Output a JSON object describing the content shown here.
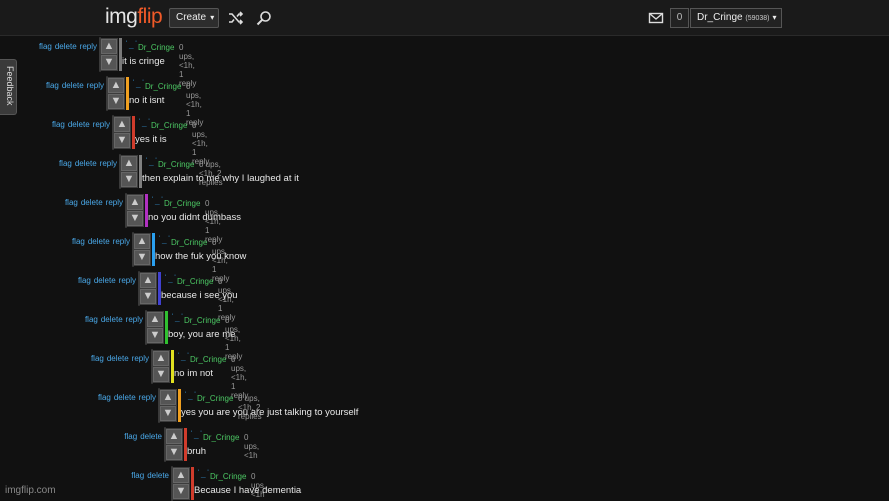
{
  "header": {
    "logo_main": "img",
    "logo_accent": "flip",
    "create_label": "Create",
    "shuffle_icon": "shuffle-icon",
    "search_icon": "search-icon",
    "mail_icon": "mail-icon",
    "notification_count": "0",
    "username": "Dr_Cringe",
    "points": "(59038)"
  },
  "feedback_label": "Feedback",
  "watermark": "imgflip.com",
  "colors": {
    "depth": [
      "#7a7a7a",
      "#f0a020",
      "#d03c2c",
      "#808080",
      "#b030c0",
      "#2aa0f0",
      "#4040d0",
      "#30c030",
      "#e0e020",
      "#f0a020",
      "#d03c2c",
      "#d03c2c"
    ],
    "username": "#4cc864",
    "link": "#4aa8e8"
  },
  "comments": [
    {
      "user": "Dr_Cringe",
      "meta": "0 ups, <1h, 1 reply",
      "text": "it is cringe",
      "actions": [
        "flag",
        "delete",
        "reply"
      ]
    },
    {
      "user": "Dr_Cringe",
      "meta": "0 ups, <1h, 1 reply",
      "text": "no it isnt",
      "actions": [
        "flag",
        "delete",
        "reply"
      ]
    },
    {
      "user": "Dr_Cringe",
      "meta": "0 ups, <1h, 1 reply",
      "text": "yes it is",
      "actions": [
        "flag",
        "delete",
        "reply"
      ]
    },
    {
      "user": "Dr_Cringe",
      "meta": "0 ups, <1h, 2 replies",
      "text": "then explain to me why I laughed at it",
      "actions": [
        "flag",
        "delete",
        "reply"
      ]
    },
    {
      "user": "Dr_Cringe",
      "meta": "0 ups, <1h, 1 reply",
      "text": "no you didnt dumbass",
      "actions": [
        "flag",
        "delete",
        "reply"
      ]
    },
    {
      "user": "Dr_Cringe",
      "meta": "0 ups, <1h, 1 reply",
      "text": "how the fuk you know",
      "actions": [
        "flag",
        "delete",
        "reply"
      ]
    },
    {
      "user": "Dr_Cringe",
      "meta": "0 ups, <1h, 1 reply",
      "text": "because i see you",
      "actions": [
        "flag",
        "delete",
        "reply"
      ]
    },
    {
      "user": "Dr_Cringe",
      "meta": "0 ups, <1h, 1 reply",
      "text": "boy, you are me",
      "actions": [
        "flag",
        "delete",
        "reply"
      ]
    },
    {
      "user": "Dr_Cringe",
      "meta": "0 ups, <1h, 1 reply",
      "text": "no im not",
      "actions": [
        "flag",
        "delete",
        "reply"
      ]
    },
    {
      "user": "Dr_Cringe",
      "meta": "0 ups, <1h, 2 replies",
      "text": "yes you are you are just talking to yourself",
      "actions": [
        "flag",
        "delete",
        "reply"
      ]
    },
    {
      "user": "Dr_Cringe",
      "meta": "0 ups, <1h",
      "text": "bruh",
      "actions": [
        "flag",
        "delete"
      ]
    },
    {
      "user": "Dr_Cringe",
      "meta": "0 ups, <1h",
      "text": "Because I have dementia",
      "actions": [
        "flag",
        "delete"
      ]
    }
  ]
}
